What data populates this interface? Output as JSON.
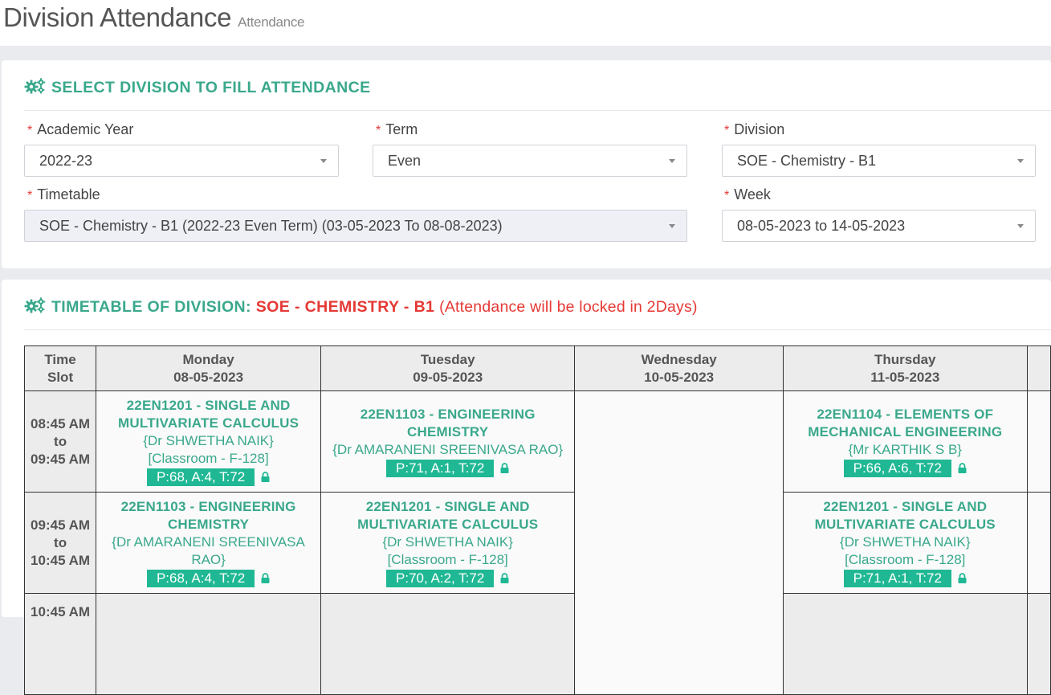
{
  "header": {
    "title": "Division Attendance",
    "subtitle": "Attendance"
  },
  "select_panel": {
    "heading": "SELECT DIVISION TO FILL ATTENDANCE",
    "required_mark": "*",
    "fields": {
      "academic_year": {
        "label": "Academic Year",
        "value": "2022-23"
      },
      "term": {
        "label": "Term",
        "value": "Even"
      },
      "division": {
        "label": "Division",
        "value": "SOE - Chemistry - B1"
      },
      "timetable": {
        "label": "Timetable",
        "value": "SOE - Chemistry - B1 (2022-23 Even Term) (03-05-2023 To 08-08-2023)"
      },
      "week": {
        "label": "Week",
        "value": "08-05-2023 to 14-05-2023"
      }
    }
  },
  "timetable_panel": {
    "heading_prefix": "TIMETABLE OF DIVISION:",
    "division_name": "SOE - CHEMISTRY - B1",
    "lock_note": "(Attendance will be locked in 2Days)",
    "columns": {
      "slot": [
        "Time",
        "Slot"
      ],
      "days": [
        {
          "day": "Monday",
          "date": "08-05-2023"
        },
        {
          "day": "Tuesday",
          "date": "09-05-2023"
        },
        {
          "day": "Wednesday",
          "date": "10-05-2023"
        },
        {
          "day": "Thursday",
          "date": "11-05-2023"
        }
      ]
    },
    "rows": [
      {
        "slot": [
          "08:45 AM",
          "to",
          "09:45 AM"
        ],
        "monday": {
          "course": [
            "22EN1201 - SINGLE AND",
            "MULTIVARIATE CALCULUS"
          ],
          "faculty": [
            "{Dr SHWETHA NAIK}"
          ],
          "room": "[Classroom - F-128]",
          "stats": "P:68, A:4, T:72"
        },
        "tuesday": {
          "course": [
            "22EN1103 - ENGINEERING",
            "CHEMISTRY"
          ],
          "faculty": [
            "{Dr AMARANENI SREENIVASA RAO}"
          ],
          "stats": "P:71, A:1, T:72"
        },
        "thursday": {
          "course": [
            "22EN1104 - ELEMENTS OF",
            "MECHANICAL ENGINEERING"
          ],
          "faculty": [
            "{Mr KARTHIK S B}"
          ],
          "stats": "P:66, A:6, T:72"
        }
      },
      {
        "slot": [
          "09:45 AM",
          "to",
          "10:45 AM"
        ],
        "monday": {
          "course": [
            "22EN1103 - ENGINEERING",
            "CHEMISTRY"
          ],
          "faculty": [
            "{Dr AMARANENI SREENIVASA",
            "RAO}"
          ],
          "stats": "P:68, A:4, T:72"
        },
        "tuesday": {
          "course": [
            "22EN1201 - SINGLE AND",
            "MULTIVARIATE CALCULUS"
          ],
          "faculty": [
            "{Dr SHWETHA NAIK}"
          ],
          "room": "[Classroom - F-128]",
          "stats": "P:70, A:2, T:72"
        },
        "thursday": {
          "course": [
            "22EN1201 - SINGLE AND",
            "MULTIVARIATE CALCULUS"
          ],
          "faculty": [
            "{Dr SHWETHA NAIK}"
          ],
          "room": "[Classroom - F-128]",
          "stats": "P:71, A:1, T:72"
        }
      },
      {
        "slot": [
          "10:45 AM"
        ]
      }
    ]
  },
  "colors": {
    "accent": "#3aa88c",
    "badge": "#20b894",
    "alert": "#e53935"
  },
  "icons": {
    "heading": "gears-icon",
    "stats": "lock-icon",
    "select": "chevron-down-icon"
  }
}
